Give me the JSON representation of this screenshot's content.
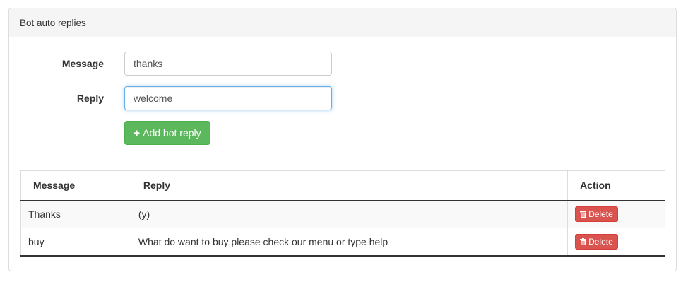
{
  "panel": {
    "title": "Bot auto replies"
  },
  "form": {
    "message_label": "Message",
    "message_value": "thanks",
    "reply_label": "Reply",
    "reply_value": "welcome",
    "add_button_label": "Add bot reply"
  },
  "table": {
    "headers": {
      "message": "Message",
      "reply": "Reply",
      "action": "Action"
    },
    "rows": [
      {
        "message": "Thanks",
        "reply": "(y)",
        "action": "Delete"
      },
      {
        "message": "buy",
        "reply": "What do want to buy please check our menu or type help",
        "action": "Delete"
      }
    ]
  },
  "colors": {
    "success": "#5cb85c",
    "danger": "#d9534f",
    "focus": "#66afe9"
  },
  "icons": {
    "add": "plus-icon",
    "delete": "trash-icon"
  }
}
